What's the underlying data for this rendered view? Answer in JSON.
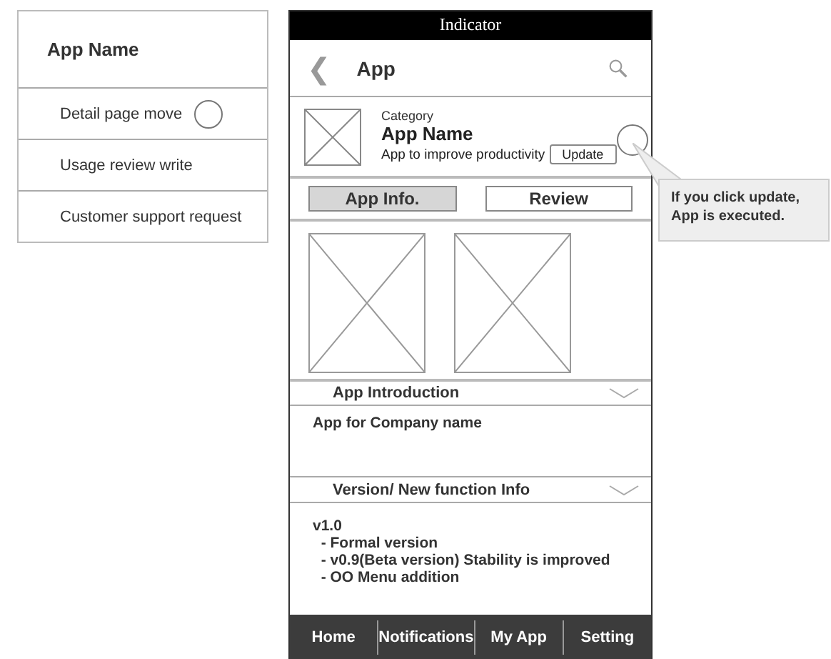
{
  "menu": {
    "title": "App Name",
    "items": [
      {
        "label": "Detail page move",
        "marked": true
      },
      {
        "label": "Usage review write",
        "marked": false
      },
      {
        "label": "Customer support request",
        "marked": false
      }
    ]
  },
  "phone": {
    "status_bar": "Indicator",
    "header": {
      "back": "❮",
      "title": "App"
    },
    "app": {
      "category": "Category",
      "name": "App Name",
      "description": "App to improve productivity",
      "update_button": "Update",
      "update_marked": true
    },
    "tabs": [
      {
        "label": "App Info.",
        "selected": true
      },
      {
        "label": "Review",
        "selected": false
      }
    ],
    "sections": [
      {
        "title": "App Introduction",
        "expanded": false,
        "lines": [
          "App for Company name"
        ]
      },
      {
        "title": "Version/ New function Info",
        "expanded": false,
        "lines": [
          "v1.0",
          "  - Formal version",
          "  - v0.9(Beta version) Stability is improved",
          "  - OO Menu addition"
        ]
      }
    ],
    "nav": [
      "Home",
      "Notifications",
      "My App",
      "Setting"
    ]
  },
  "callout": {
    "text": "If you click update,\nApp is executed."
  }
}
